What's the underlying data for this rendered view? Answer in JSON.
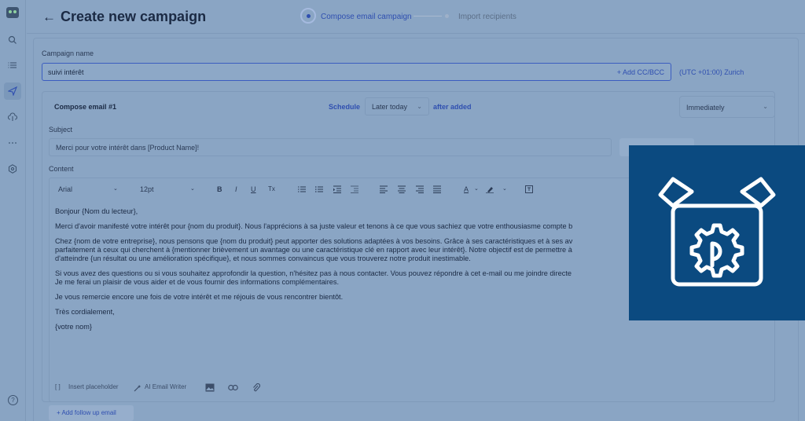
{
  "header": {
    "back_arrow": "←",
    "title": "Create new campaign",
    "steps": [
      {
        "label": "Compose email campaign",
        "active": true
      },
      {
        "label": "Import recipients",
        "active": false
      }
    ]
  },
  "campaign": {
    "name_label": "Campaign name",
    "name_value": "suivi intérêt",
    "add_cc_bcc": "+  Add CC/BCC",
    "timezone": "(UTC +01:00) Zurich"
  },
  "compose": {
    "title": "Compose email #1",
    "schedule_label": "Schedule",
    "schedule_value": "Later today",
    "after_added": "after added",
    "timing_value": "Immediately",
    "subject_label": "Subject",
    "subject_value": "Merci pour votre intérêt dans [Product Name]!",
    "content_label": "Content"
  },
  "toolbar": {
    "font": "Arial",
    "size": "12pt",
    "bold": "B",
    "italic": "I",
    "underline": "U",
    "clear": "Tx",
    "text_color": "A"
  },
  "email_body": [
    "Bonjour {Nom du lecteur},",
    "Merci d'avoir manifesté votre intérêt pour {nom du produit}. Nous l'apprécions à sa juste valeur et tenons à ce que vous sachiez que votre enthousiasme compte b",
    "Chez {nom de votre entreprise}, nous pensons que {nom du produit} peut apporter des solutions adaptées à vos besoins. Grâce à ses caractéristiques et à ses av",
    "parfaitement à ceux qui cherchent à {mentionner brièvement un avantage ou une caractéristique clé en rapport avec leur intérêt}. Notre objectif est de permettre à",
    "d'atteindre {un résultat ou une amélioration spécifique}, et nous sommes convaincus que vous trouverez notre produit inestimable.",
    "Si vous avez des questions ou si vous souhaitez approfondir la question, n'hésitez pas à nous contacter. Vous pouvez répondre à cet e-mail ou me joindre directe",
    "Je me ferai un plaisir de vous aider et de vous fournir des informations complémentaires.",
    "Je vous remercie encore une fois de votre intérêt et me réjouis de vous rencontrer bientôt.",
    "Très cordialement,",
    "{votre nom}"
  ],
  "editor_footer": {
    "insert_placeholder": "Insert placeholder",
    "ai_writer": "AI Email Writer",
    "placeholder_glyph": "[ ]"
  },
  "follow_up": "+   Add follow up email",
  "help": "?",
  "colors": {
    "overlay": "#8aa5c4",
    "accent": "#2f4fb0",
    "logo_card": "#0b4a80"
  },
  "icons": [
    "logo-icon",
    "search-icon",
    "list-icon",
    "send-icon",
    "cloud-upload-icon",
    "more-icon",
    "settings-icon",
    "help-icon",
    "plugin-box-gear-icon"
  ]
}
